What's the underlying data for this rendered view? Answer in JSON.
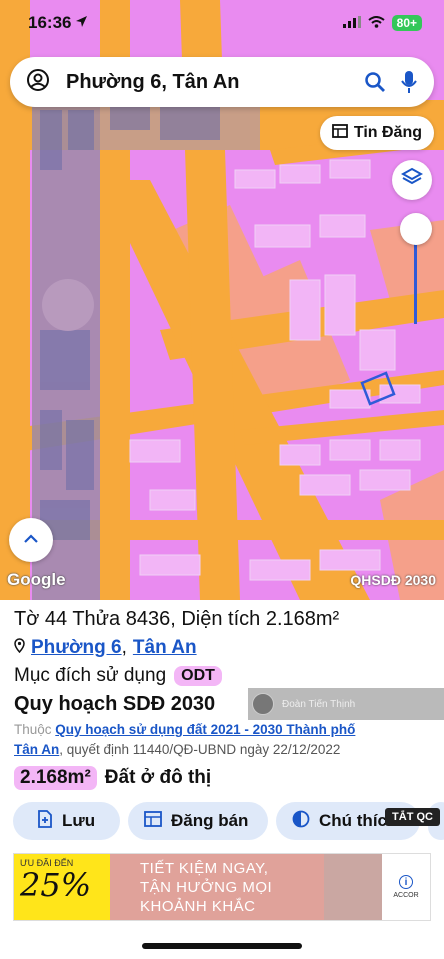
{
  "status_bar": {
    "time": "16:36",
    "battery": "80+"
  },
  "search": {
    "text": "Phường 6, Tân An"
  },
  "map": {
    "tin_dang_label": "Tin Đăng",
    "attribution": "Google",
    "layer_badge": "QHSDĐ 2030",
    "colors": {
      "road": "#f7a93b",
      "residential": "#e98bf0",
      "salmon": "#f5a08a",
      "selection": "#2f5bd8"
    }
  },
  "parcel": {
    "title": "Tờ 44 Thửa 8436, Diện tích 2.168m²",
    "ward_link": "Phường 6",
    "separator": ",",
    "city_link": "Tân An",
    "purpose_label": "Mục đích sử dụng",
    "purpose_code": "ODT",
    "plan_heading": "Quy hoạch SDĐ 2030",
    "plan_prefix": "Thuộc",
    "plan_link_1": "Quy hoạch sử dụng đất 2021 - 2030 Thành phố",
    "plan_link_2": "Tân An",
    "plan_suffix": ", quyết định 11440/QĐ-UBND ngày 22/12/2022",
    "area_value": "2.168m²",
    "area_type": "Đất ở đô thị"
  },
  "overlay_user": {
    "name": "Đoàn Tiến Thịnh"
  },
  "actions": {
    "save": "Lưu",
    "post_sale": "Đăng bán",
    "legend": "Chú thích"
  },
  "ad": {
    "hide_label": "TẮT QC",
    "promo_small": "ƯU ĐÃI ĐẾN",
    "promo_big": "25%",
    "line1": "TIẾT KIỆM NGAY,",
    "line2": "TẬN HƯỞNG MỌI",
    "line3": "KHOẢNH KHẮC",
    "brand": "ACCOR"
  }
}
